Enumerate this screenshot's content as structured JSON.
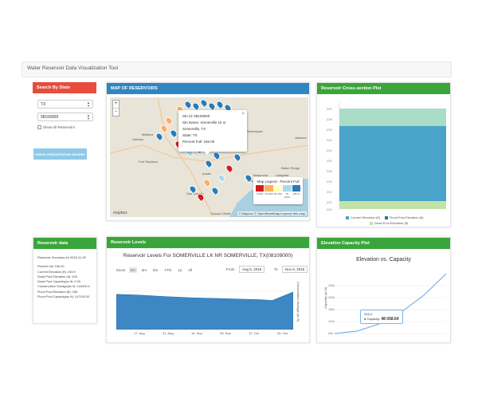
{
  "app": {
    "title": "Water Reservoir Data Visualization Tool"
  },
  "search": {
    "heading": "Search By State",
    "state_value": "TX",
    "reservoir_value": "08109000",
    "show_all_label": "Show All Reservoirs",
    "precip_button": "CHECK PRECIPITATION NEARBY"
  },
  "map": {
    "heading": "MAP OF RESERVOIRS",
    "zoom_in": "+",
    "zoom_out": "−",
    "popup": {
      "close": "×",
      "lines": [
        "Stn Id: 08109000",
        "Stn Name: Somerville Lk nr Somerville, TX",
        "State: TX",
        "Percent Full: 166.00"
      ]
    },
    "legend": {
      "title": "Map Legend - Percent Full",
      "labels": [
        "0-25%",
        "25-50%",
        "50-75%",
        "75-100%",
        "100+%"
      ],
      "colors": [
        "#d7191c",
        "#fdae61",
        "#ffffbf",
        "#abd9e9",
        "#2c7bb6"
      ]
    },
    "cities": [
      "Shreveport",
      "Odessa",
      "Midland",
      "Austin",
      "San Antonio",
      "Houston",
      "Beaumont",
      "Baton Rouge",
      "Lafayette",
      "Fort Stockton",
      "Corpus Christi",
      "Jackson"
    ],
    "attribution": "© Mapbox © OpenStreetMap Improve this map",
    "logo": "mapbox"
  },
  "cross_section": {
    "heading": "Reservoir Cross-section Plot",
    "y_ticks": [
      "240",
      "238",
      "236",
      "234",
      "232",
      "230",
      "228",
      "226",
      "224",
      "222",
      "220"
    ],
    "legend": [
      "Current Elevation (ft)",
      "Flood Pool Elevation (ft)",
      "Dead Pool Elevation (ft)"
    ],
    "colors": {
      "current": "#4aa3c9",
      "flood": "#a9ddc8",
      "dead": "#c2e3a6"
    }
  },
  "reservoir_data": {
    "heading": "Reservoir data",
    "summary_title": "Reservoir Summary for 2015-11-09",
    "lines": [
      "Percent full: 166.00",
      "Current Elevation (ft): 245.9",
      "Dead Pool Elevation (ft): 206",
      "Dead Pool Capacity(ac ft): 0.00",
      "Conservation Storage(ac ft): 144400.0",
      "Flood Pool Elevation (ft): 258",
      "Flood Pool Capacity(ac ft): 147100.00"
    ]
  },
  "levels": {
    "heading": "Reservoir Levels",
    "title": "Reservoir Levels For SOMERVILLE LK NR SOMERVILLE, TX(08109000)",
    "zoom_label": "Zoom",
    "zoom_buttons": [
      "1m",
      "3m",
      "6m",
      "YTD",
      "1y",
      "All"
    ],
    "from_label": "From",
    "from_date": "Aug 5, 2015",
    "to_label": "To",
    "to_date": "Nov 6, 2015",
    "x_ticks": [
      "17. Aug",
      "31. Aug",
      "14. Sep",
      "28. Sep",
      "12. Oct",
      "26. Oct"
    ],
    "y_label": "Conservation Storage (ac ft)"
  },
  "elevation": {
    "heading": "Elevation Capacity Plot",
    "title": "Elevation vs. Capacity",
    "y_label": "Capacity (ac ft)",
    "y_ticks": [
      "250k",
      "200k",
      "150k",
      "100k",
      "50k",
      "0"
    ],
    "tooltip_x": "226.4",
    "tooltip_label": "Capacity:",
    "tooltip_value": "48 058.64"
  },
  "chart_data": [
    {
      "type": "area",
      "title": "Reservoir Levels For SOMERVILLE LK NR SOMERVILLE, TX(08109000)",
      "xlabel": "",
      "ylabel": "Conservation Storage (ac ft)",
      "x": [
        "2015-08-05",
        "2015-08-17",
        "2015-08-31",
        "2015-09-14",
        "2015-09-28",
        "2015-10-12",
        "2015-10-20",
        "2015-10-26",
        "2015-11-06"
      ],
      "y": [
        0.92,
        0.9,
        0.86,
        0.83,
        0.81,
        0.79,
        0.78,
        0.76,
        0.98
      ],
      "grid": true
    },
    {
      "type": "line",
      "title": "Elevation vs. Capacity",
      "ylabel": "Capacity (ac ft)",
      "x": [
        205,
        215,
        225,
        226.4,
        235,
        245,
        255
      ],
      "y": [
        0,
        10000,
        40000,
        48058.64,
        90000,
        160000,
        250000
      ],
      "ylim": [
        0,
        250000
      ]
    }
  ]
}
